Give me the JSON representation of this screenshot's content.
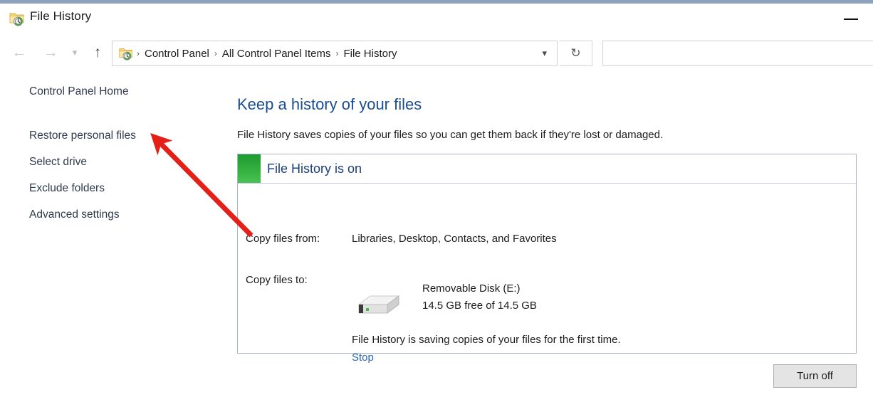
{
  "window": {
    "title": "File History",
    "app_icon": "folder-history-icon",
    "minimize_label": "Minimize"
  },
  "nav": {
    "back_icon": "arrow-left-icon",
    "forward_icon": "arrow-right-icon",
    "recent_icon": "chevron-down-icon",
    "up_icon": "arrow-up-icon",
    "refresh_icon": "refresh-icon",
    "breadcrumb_icon": "folder-history-icon",
    "breadcrumb_dropdown_icon": "chevron-down-icon",
    "breadcrumbs": [
      "Control Panel",
      "All Control Panel Items",
      "File History"
    ],
    "separator": "›"
  },
  "search": {
    "value": "",
    "placeholder": ""
  },
  "sidebar": {
    "home_label": "Control Panel Home",
    "items": [
      {
        "label": "Restore personal files"
      },
      {
        "label": "Select drive"
      },
      {
        "label": "Exclude folders"
      },
      {
        "label": "Advanced settings"
      }
    ]
  },
  "main": {
    "title": "Keep a history of your files",
    "description": "File History saves copies of your files so you can get them back if they're lost or damaged.",
    "status": {
      "title": "File History is on",
      "indicator_color": "#33b03f"
    },
    "copy_from_label": "Copy files from:",
    "copy_from_value": "Libraries, Desktop, Contacts, and Favorites",
    "copy_to_label": "Copy files to:",
    "drive_icon": "external-drive-icon",
    "drive_name": "Removable Disk (E:)",
    "drive_space": "14.5 GB free of 14.5 GB",
    "saving_text": "File History is saving copies of your files for the first time.",
    "stop_label": "Stop"
  },
  "footer": {
    "turn_off_label": "Turn off"
  },
  "annotation": {
    "arrow_color": "#e32119",
    "points_to": "Restore personal files"
  },
  "colors": {
    "heading": "#1a4d91",
    "link": "#2a65ae",
    "panel_border": "#aab0c8",
    "title_border": "#8ea2bd"
  }
}
